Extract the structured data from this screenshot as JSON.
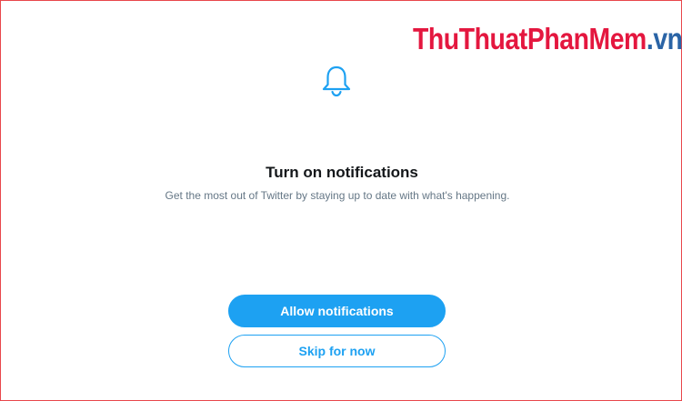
{
  "watermark": {
    "part1": "ThuThuat",
    "part2": "PhanMem",
    "part3": ".vn"
  },
  "prompt": {
    "icon": "bell-icon",
    "title": "Turn on notifications",
    "description": "Get the most out of Twitter by staying up to date with what's happening."
  },
  "actions": {
    "allow_label": "Allow notifications",
    "skip_label": "Skip for now"
  },
  "colors": {
    "accent": "#1da1f2",
    "title_text": "#14171a",
    "secondary_text": "#657786",
    "watermark_red": "#e4173f",
    "watermark_blue": "#2a64a6",
    "frame_border": "#e8474b"
  }
}
